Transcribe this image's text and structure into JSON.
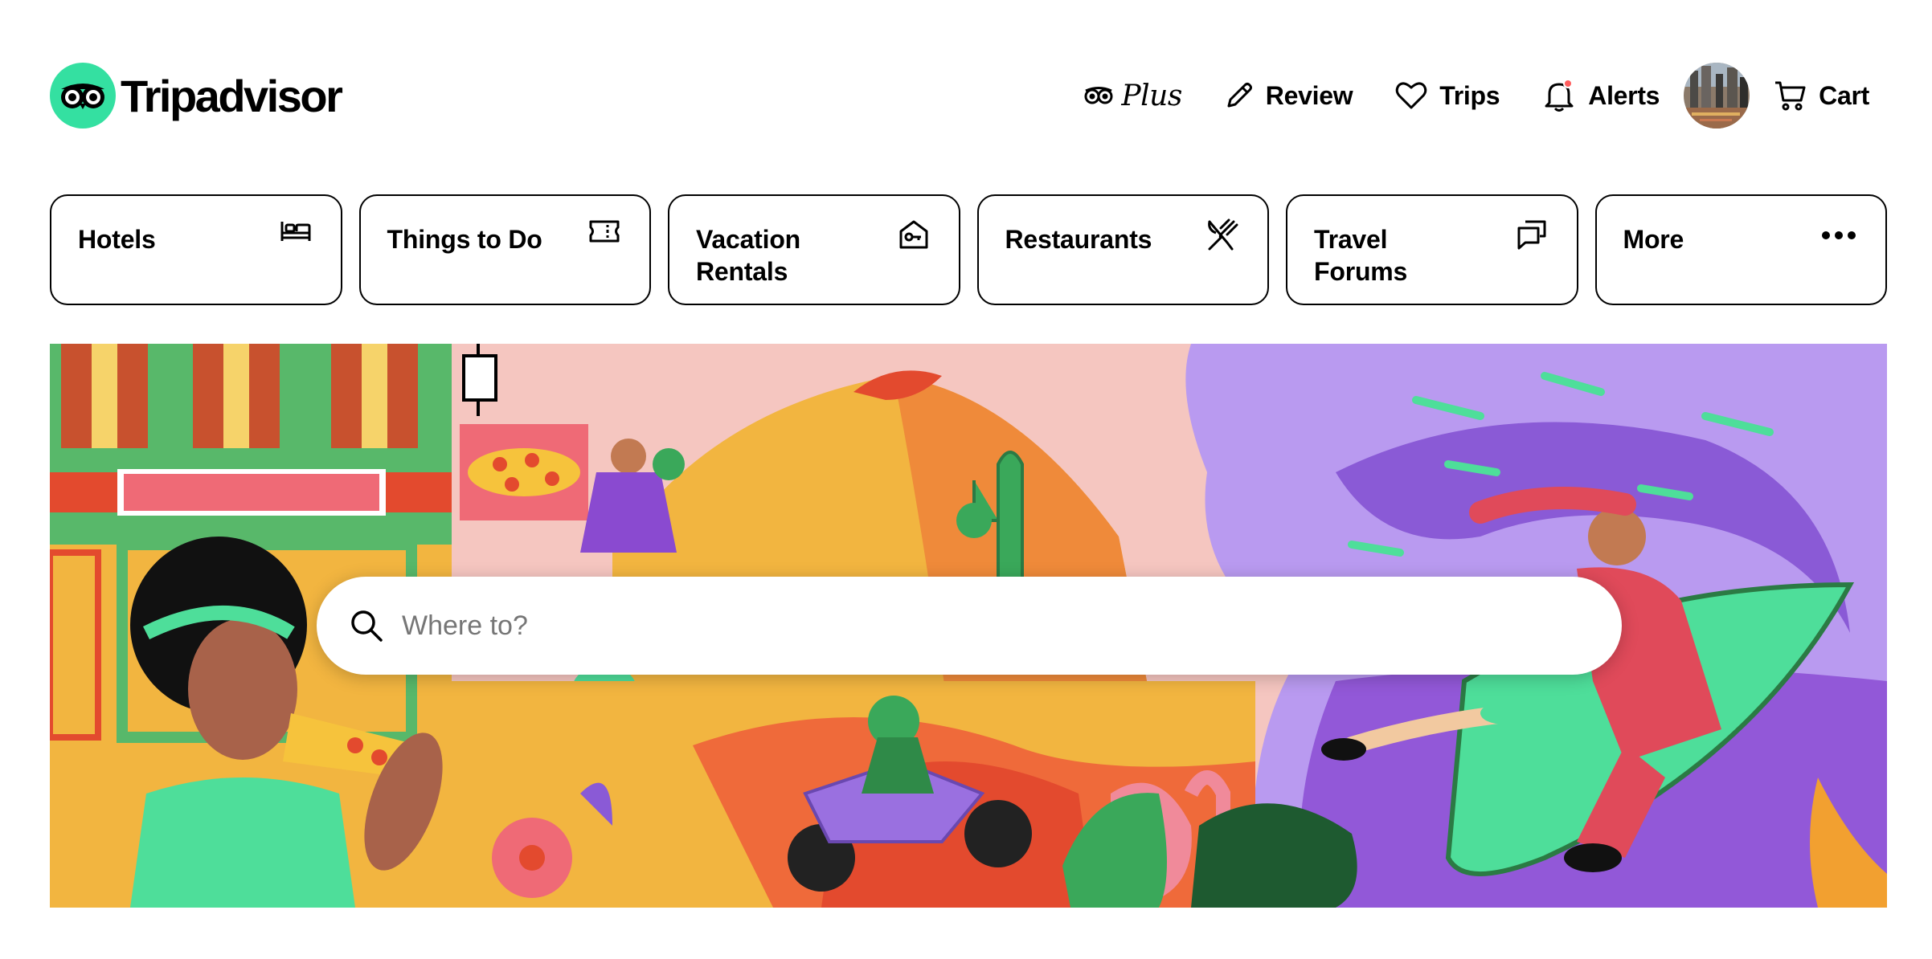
{
  "brand": {
    "name": "Tripadvisor",
    "accent_color": "#34e0a1"
  },
  "nav": {
    "plus_label": "Plus",
    "review_label": "Review",
    "trips_label": "Trips",
    "alerts_label": "Alerts",
    "cart_label": "Cart",
    "alerts_badge_color": "#ff5d5d"
  },
  "tabs": [
    {
      "label": "Hotels",
      "icon": "bed-icon"
    },
    {
      "label": "Things to Do",
      "icon": "ticket-icon"
    },
    {
      "label": "Vacation Rentals",
      "icon": "house-key-icon"
    },
    {
      "label": "Restaurants",
      "icon": "fork-knife-icon"
    },
    {
      "label": "Travel Forums",
      "icon": "chat-bubbles-icon"
    },
    {
      "label": "More",
      "icon": "more-dots-icon"
    }
  ],
  "search": {
    "placeholder": "Where to?",
    "value": ""
  }
}
